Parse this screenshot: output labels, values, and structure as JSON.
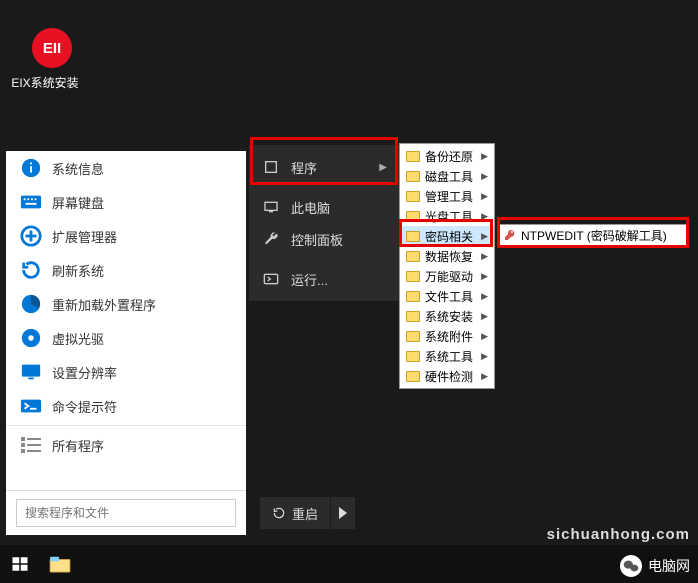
{
  "desktop": {
    "icon_text": "EII",
    "icon_label": "EIX系统安装"
  },
  "start_menu": {
    "items": [
      {
        "label": "系统信息",
        "icon": "info"
      },
      {
        "label": "屏幕键盘",
        "icon": "keyboard"
      },
      {
        "label": "扩展管理器",
        "icon": "plus"
      },
      {
        "label": "刷新系统",
        "icon": "refresh"
      },
      {
        "label": "重新加载外置程序",
        "icon": "pie"
      },
      {
        "label": "虚拟光驱",
        "icon": "disc"
      },
      {
        "label": "设置分辨率",
        "icon": "monitor"
      },
      {
        "label": "命令提示符",
        "icon": "cmd"
      },
      {
        "label": "所有程序",
        "icon": "list"
      }
    ],
    "search_placeholder": "搜索程序和文件"
  },
  "context_menu": {
    "items": [
      {
        "label": "程序",
        "icon": "app",
        "has_sub": true
      },
      {
        "label": "此电脑",
        "icon": "pc",
        "has_sub": false
      },
      {
        "label": "控制面板",
        "icon": "wrench",
        "has_sub": false
      },
      {
        "label": "运行...",
        "icon": "run",
        "has_sub": false
      }
    ]
  },
  "sub_menu": {
    "items": [
      "备份还原",
      "磁盘工具",
      "管理工具",
      "光盘工具",
      "密码相关",
      "数据恢复",
      "万能驱动",
      "文件工具",
      "系统安装",
      "系统附件",
      "系统工具",
      "硬件检测"
    ],
    "selected_index": 4
  },
  "final_menu": {
    "label": "NTPWEDIT (密码破解工具)"
  },
  "taskbar_ctrl": {
    "restart": "重启"
  },
  "watermark": {
    "site": "sichuanhong.com",
    "brand": "电脑网"
  }
}
